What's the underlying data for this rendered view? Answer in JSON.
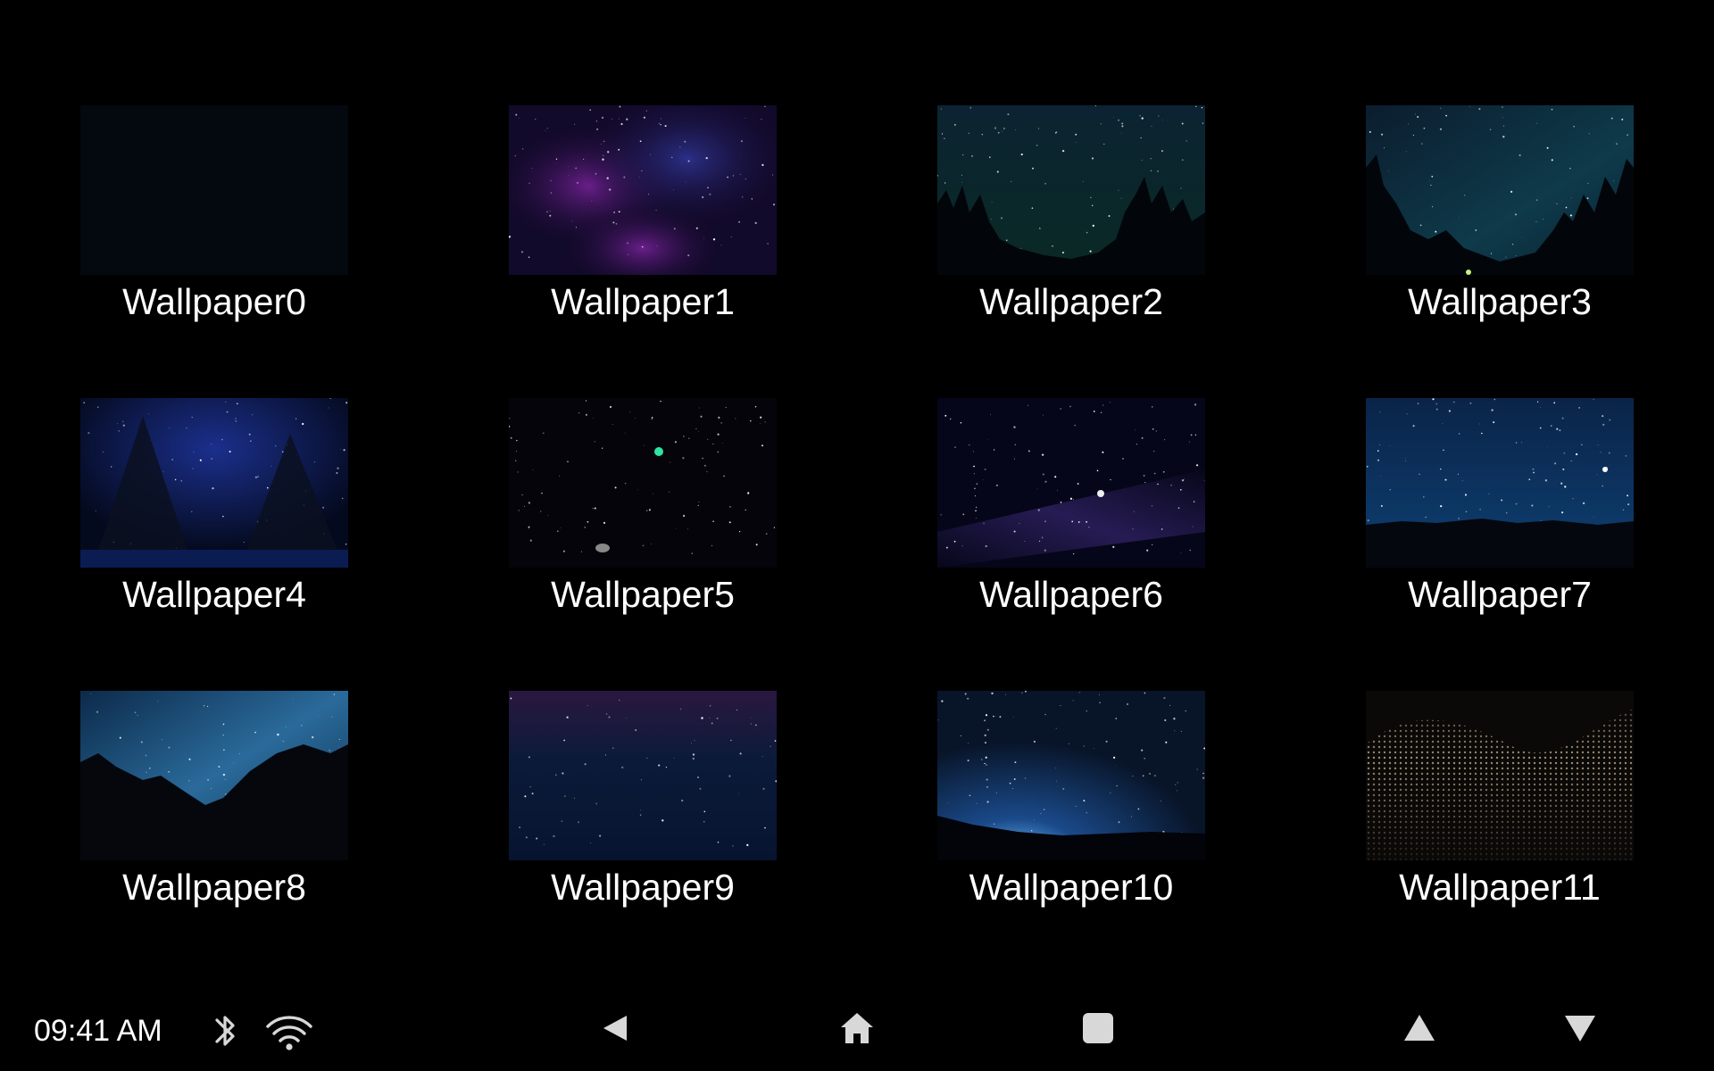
{
  "wallpapers": [
    {
      "label": "Wallpaper0"
    },
    {
      "label": "Wallpaper1"
    },
    {
      "label": "Wallpaper2"
    },
    {
      "label": "Wallpaper3"
    },
    {
      "label": "Wallpaper4"
    },
    {
      "label": "Wallpaper5"
    },
    {
      "label": "Wallpaper6"
    },
    {
      "label": "Wallpaper7"
    },
    {
      "label": "Wallpaper8"
    },
    {
      "label": "Wallpaper9"
    },
    {
      "label": "Wallpaper10"
    },
    {
      "label": "Wallpaper11"
    }
  ],
  "status_bar": {
    "time": "09:41 AM",
    "icons": [
      "bluetooth-icon",
      "wifi-icon"
    ]
  },
  "navigation": {
    "buttons": [
      "back-icon",
      "home-icon",
      "recents-icon",
      "volume-up-icon",
      "volume-down-icon"
    ]
  },
  "colors": {
    "background": "#000000",
    "text": "#ffffff",
    "icon": "#d8d8d8"
  }
}
